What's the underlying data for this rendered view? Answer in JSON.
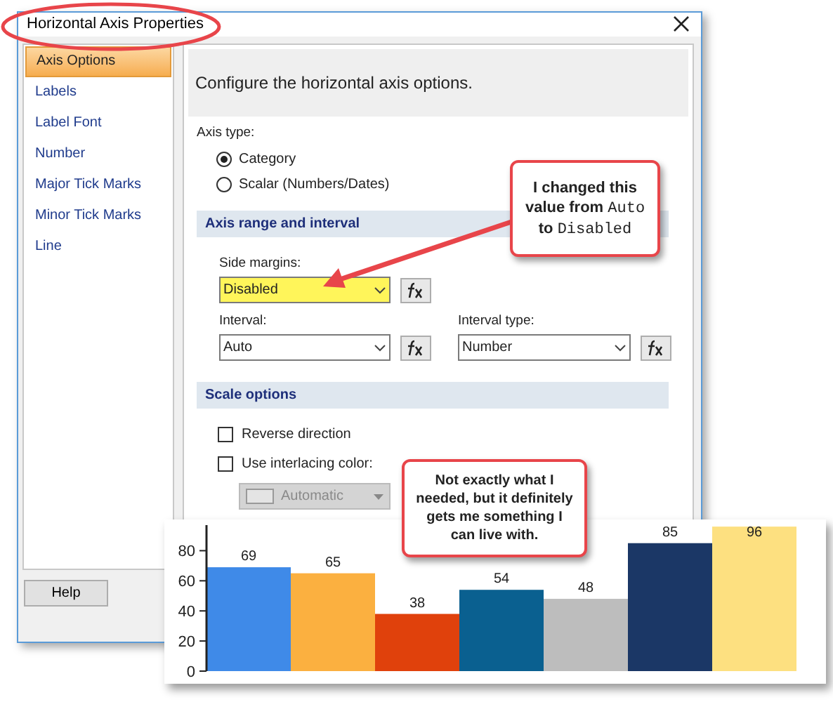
{
  "window": {
    "title": "Horizontal Axis Properties"
  },
  "sidebar": {
    "items": [
      {
        "label": "Axis Options",
        "selected": true
      },
      {
        "label": "Labels",
        "selected": false
      },
      {
        "label": "Label Font",
        "selected": false
      },
      {
        "label": "Number",
        "selected": false
      },
      {
        "label": "Major Tick Marks",
        "selected": false
      },
      {
        "label": "Minor Tick Marks",
        "selected": false
      },
      {
        "label": "Line",
        "selected": false
      }
    ]
  },
  "help_button": "Help",
  "panel": {
    "heading": "Configure the horizontal axis options.",
    "axis_type": {
      "label": "Axis type:",
      "options": [
        {
          "label": "Category",
          "selected": true
        },
        {
          "label": "Scalar (Numbers/Dates)",
          "selected": false
        }
      ]
    },
    "range_section": {
      "title": "Axis range and interval",
      "side_margins": {
        "label": "Side margins:",
        "value": "Disabled",
        "highlighted": true
      },
      "interval": {
        "label": "Interval:",
        "value": "Auto"
      },
      "interval_type": {
        "label": "Interval type:",
        "value": "Number"
      }
    },
    "scale_section": {
      "title": "Scale options",
      "checkboxes": [
        {
          "label": "Reverse direction",
          "checked": false
        },
        {
          "label": "Use interlacing color:",
          "checked": false
        }
      ],
      "color_dropdown": {
        "value": "Automatic",
        "disabled": true
      }
    }
  },
  "callouts": [
    {
      "parts": [
        {
          "kind": "plain",
          "text": "I changed this value from "
        },
        {
          "kind": "code",
          "text": "Auto"
        },
        {
          "kind": "plain",
          "text": " to "
        },
        {
          "kind": "code",
          "text": "Disabled"
        }
      ]
    },
    {
      "parts": [
        {
          "kind": "plain",
          "text": "Not exactly what I needed, but it definitely gets me something I can live with."
        }
      ]
    }
  ],
  "chart": {
    "chart_data": {
      "type": "bar",
      "values": [
        69,
        65,
        38,
        54,
        48,
        85,
        96
      ],
      "colors": [
        "#3f8ae8",
        "#fbb040",
        "#e0410c",
        "#0a6090",
        "#bdbdbd",
        "#1b3766",
        "#fde080"
      ],
      "ylim": [
        0,
        97
      ],
      "yticks": [
        0,
        20,
        40,
        60,
        80
      ],
      "data_labels": true
    }
  }
}
